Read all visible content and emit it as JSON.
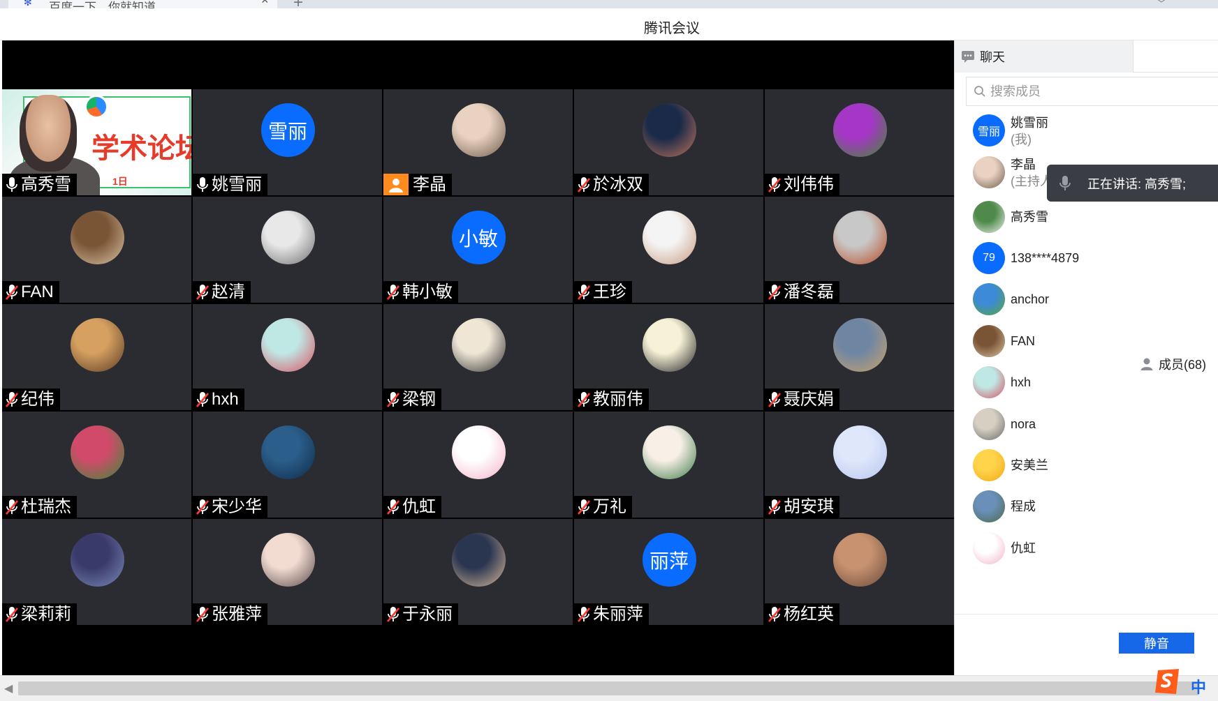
{
  "browser": {
    "tab_title": "百度一下，你就知道",
    "close_glyph": "×",
    "new_tab_glyph": "+",
    "dropdown_glyph": "﹀"
  },
  "window": {
    "title": "腾讯会议"
  },
  "tiles": [
    {
      "name": "高秀雪",
      "mic": "on",
      "type": "screen",
      "share_text": "学术论坛",
      "share_date": "1日"
    },
    {
      "name": "姚雪丽",
      "mic": "on",
      "type": "text",
      "avatar_text": "雪丽"
    },
    {
      "name": "李晶",
      "mic": "host",
      "type": "photo",
      "colors": [
        "#e9d2c2",
        "#6f5a4a"
      ]
    },
    {
      "name": "於冰双",
      "mic": "off",
      "type": "photo",
      "colors": [
        "#1a2a48",
        "#c0745a"
      ]
    },
    {
      "name": "刘伟伟",
      "mic": "off",
      "type": "photo",
      "colors": [
        "#a636c8",
        "#3f8a2f"
      ]
    },
    {
      "name": "FAN",
      "mic": "off",
      "type": "photo",
      "colors": [
        "#7a5535",
        "#d9c3a6"
      ]
    },
    {
      "name": "赵清",
      "mic": "off",
      "type": "photo",
      "colors": [
        "#e8e8e8",
        "#6f6f6f"
      ]
    },
    {
      "name": "韩小敏",
      "mic": "off",
      "type": "text",
      "avatar_text": "小敏"
    },
    {
      "name": "王珍",
      "mic": "off",
      "type": "photo",
      "colors": [
        "#f4f4f4",
        "#c89a80"
      ]
    },
    {
      "name": "潘冬磊",
      "mic": "off",
      "type": "photo",
      "colors": [
        "#c8c8c8",
        "#b84a22"
      ]
    },
    {
      "name": "纪伟",
      "mic": "off",
      "type": "photo",
      "colors": [
        "#d5a060",
        "#5a3a24"
      ]
    },
    {
      "name": "hxh",
      "mic": "off",
      "type": "photo",
      "colors": [
        "#bfe7e4",
        "#d85260"
      ]
    },
    {
      "name": "梁钢",
      "mic": "off",
      "type": "photo",
      "colors": [
        "#efe6d6",
        "#333333"
      ]
    },
    {
      "name": "教丽伟",
      "mic": "off",
      "type": "photo",
      "colors": [
        "#f6f2d8",
        "#222222"
      ]
    },
    {
      "name": "聂庆娟",
      "mic": "off",
      "type": "photo",
      "colors": [
        "#6f86a3",
        "#c9a36a"
      ]
    },
    {
      "name": "杜瑞杰",
      "mic": "off",
      "type": "photo",
      "colors": [
        "#d24a6a",
        "#3a8a3a"
      ]
    },
    {
      "name": "宋少华",
      "mic": "off",
      "type": "photo",
      "colors": [
        "#2b5e8a",
        "#0f2a48"
      ]
    },
    {
      "name": "仇虹",
      "mic": "off",
      "type": "photo",
      "colors": [
        "#ffffff",
        "#f3b2c8"
      ]
    },
    {
      "name": "万礼",
      "mic": "off",
      "type": "photo",
      "colors": [
        "#f8efe6",
        "#3c7a4a"
      ]
    },
    {
      "name": "胡安琪",
      "mic": "off",
      "type": "photo",
      "colors": [
        "#dfe7fb",
        "#b7c6ef"
      ]
    },
    {
      "name": "梁莉莉",
      "mic": "off",
      "type": "photo",
      "colors": [
        "#3a3a6a",
        "#7a8ab8"
      ]
    },
    {
      "name": "张雅萍",
      "mic": "off",
      "type": "photo",
      "colors": [
        "#f2dcd2",
        "#5a4a4a"
      ]
    },
    {
      "name": "于永丽",
      "mic": "off",
      "type": "photo",
      "colors": [
        "#2a3650",
        "#d8b89a"
      ]
    },
    {
      "name": "朱丽萍",
      "mic": "off",
      "type": "text",
      "avatar_text": "丽萍"
    },
    {
      "name": "杨红英",
      "mic": "off",
      "type": "photo",
      "colors": [
        "#c89270",
        "#6a4a3a"
      ]
    }
  ],
  "panel": {
    "chat_tab": "聊天",
    "members_tab": "成员(68)",
    "search_placeholder": "搜索成员",
    "members": [
      {
        "name": "姚雪丽",
        "sub": "(我)",
        "type": "text",
        "avatar_text": "雪丽"
      },
      {
        "name": "李晶",
        "sub": "(主持人)",
        "type": "photo",
        "colors": [
          "#e9d2c2",
          "#6f5a4a"
        ]
      },
      {
        "name": "高秀雪",
        "sub": "",
        "type": "photo",
        "colors": [
          "#4f8a4a",
          "#f0f0f0"
        ]
      },
      {
        "name": "138****4879",
        "sub": "",
        "type": "text",
        "avatar_text": "79"
      },
      {
        "name": "anchor",
        "sub": "",
        "type": "photo",
        "colors": [
          "#3c8ad8",
          "#58a83a"
        ]
      },
      {
        "name": "FAN",
        "sub": "",
        "type": "photo",
        "colors": [
          "#7a5535",
          "#d9c3a6"
        ]
      },
      {
        "name": "hxh",
        "sub": "",
        "type": "photo",
        "colors": [
          "#bfe7e4",
          "#d85260"
        ]
      },
      {
        "name": "nora",
        "sub": "",
        "type": "photo",
        "colors": [
          "#d7cfc2",
          "#6a6a6a"
        ]
      },
      {
        "name": "安美兰",
        "sub": "",
        "type": "photo",
        "colors": [
          "#ffd34a",
          "#f2a81a"
        ]
      },
      {
        "name": "程成",
        "sub": "",
        "type": "photo",
        "colors": [
          "#6a8fb8",
          "#4a6a4a"
        ]
      },
      {
        "name": "仇虹",
        "sub": "",
        "type": "photo",
        "colors": [
          "#ffffff",
          "#f3b2c8"
        ]
      }
    ],
    "speaking_tip": "正在讲话: 高秀雪;",
    "mute_button": "静音"
  },
  "taskbar": {
    "ime_label": "中",
    "scroll_arrow": "◀"
  }
}
